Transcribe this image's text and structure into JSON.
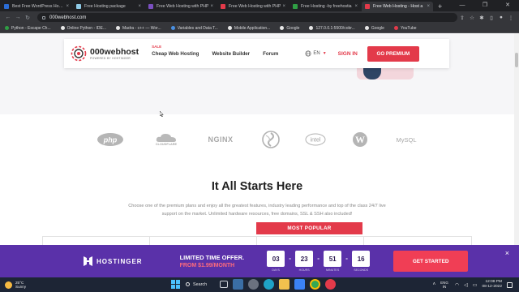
{
  "browser": {
    "tabs": [
      {
        "title": "Best Free WordPress Hostin",
        "favicon_color": "#2b6cd4",
        "active": false
      },
      {
        "title": "Free Hosting package",
        "favicon_color": "#8ecae6",
        "active": false
      },
      {
        "title": "Free Web Hosting with PHP",
        "favicon_color": "#7a4fc0",
        "active": false
      },
      {
        "title": "Free Web Hosting with PHP",
        "favicon_color": "#e33a4a",
        "active": false
      },
      {
        "title": "Free Hosting -by freehostia",
        "favicon_color": "#2f9e44",
        "active": false
      },
      {
        "title": "Free Web Hosting - Host a",
        "favicon_color": "#e33a4a",
        "active": true
      }
    ],
    "new_tab_label": "+",
    "url": "000webhost.com",
    "bookmarks": [
      {
        "label": "Python - Escape Ch...",
        "color": "#2f9e44"
      },
      {
        "label": "Online Python - IDE...",
        "color": "#e8e8e8"
      },
      {
        "label": "Madra - c++ — Wor...",
        "color": "#e8e8e8"
      },
      {
        "label": "Variables and Data T...",
        "color": "#4a90e2"
      },
      {
        "label": "Mobile Application...",
        "color": "#e8e8e8"
      },
      {
        "label": "Google",
        "color": "#e8e8e8"
      },
      {
        "label": "127.0.0.1:5500/cobr...",
        "color": "#e8e8e8"
      },
      {
        "label": "Google",
        "color": "#e8e8e8"
      },
      {
        "label": "YouTube",
        "color": "#e33a4a"
      }
    ]
  },
  "site": {
    "logo_name": "000webhost",
    "logo_sub": "POWERED BY HOSTINGER",
    "nav": {
      "sale_badge": "SALE",
      "cheap_hosting": "Cheap Web Hosting",
      "website_builder": "Website Builder",
      "forum": "Forum",
      "language": "EN",
      "sign_in": "SIGN IN",
      "go_premium": "GO PREMIUM"
    },
    "tech_logos": [
      "php",
      "CLOUDFLARE",
      "NGINX",
      "LiteSpeed",
      "intel",
      "WordPress",
      "MySQL"
    ],
    "headline": "It All Starts Here",
    "subtext": "Choose one of the premium plans and enjoy all the greatest features, industry leading performance and top of the class 24/7 live support on the market. Unlimited hardware resources, free domains, SSL & SSH also included!",
    "most_popular": "MOST POPULAR"
  },
  "promo": {
    "brand": "HOSTINGER",
    "offer_line1": "LIMITED TIME OFFER.",
    "offer_line2": "FROM $1.99/MONTH",
    "timer": [
      {
        "value": "03",
        "caption": "DAYS"
      },
      {
        "value": "23",
        "caption": "HOURS"
      },
      {
        "value": "51",
        "caption": "MINUTES"
      },
      {
        "value": "16",
        "caption": "SECONDS"
      }
    ],
    "cta": "GET STARTED",
    "close": "×"
  },
  "taskbar": {
    "temperature": "25°C",
    "weather": "Sunny",
    "search_label": "Search",
    "language": "ENG",
    "region": "IN",
    "time": "12:08 PM",
    "date": "08-12-2022",
    "accent": "#5a31a9"
  },
  "colors": {
    "brand_red": "#e33a4a",
    "promo_purple": "#5a31a9"
  }
}
